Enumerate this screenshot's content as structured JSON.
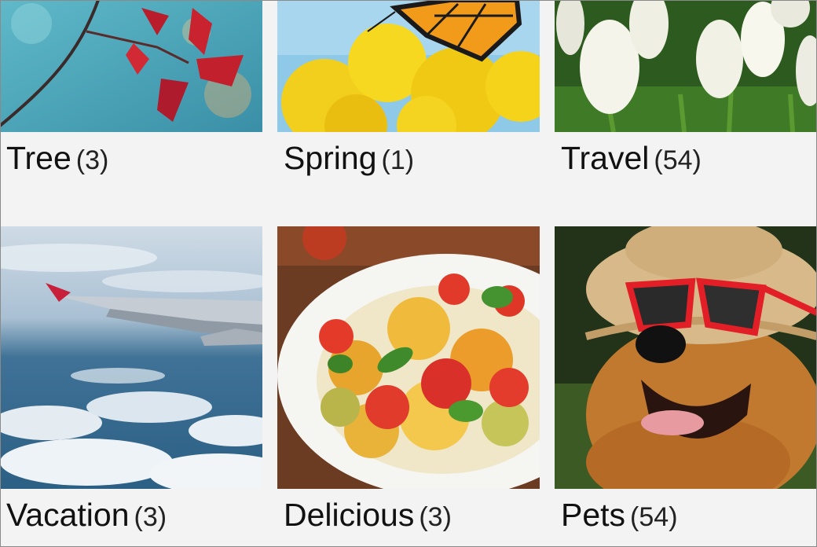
{
  "albums": [
    {
      "name": "Tree",
      "count": "(3)",
      "thumbnail": "red-leaves-branch"
    },
    {
      "name": "Spring",
      "count": "(1)",
      "thumbnail": "butterfly-on-yellow-flowers"
    },
    {
      "name": "Travel",
      "count": "(54)",
      "thumbnail": "white-tulips"
    },
    {
      "name": "Vacation",
      "count": "(3)",
      "thumbnail": "airplane-wing-over-clouds"
    },
    {
      "name": "Delicious",
      "count": "(3)",
      "thumbnail": "pasta-salad-plate"
    },
    {
      "name": "Pets",
      "count": "(54)",
      "thumbnail": "dog-with-hat-and-sunglasses"
    }
  ]
}
